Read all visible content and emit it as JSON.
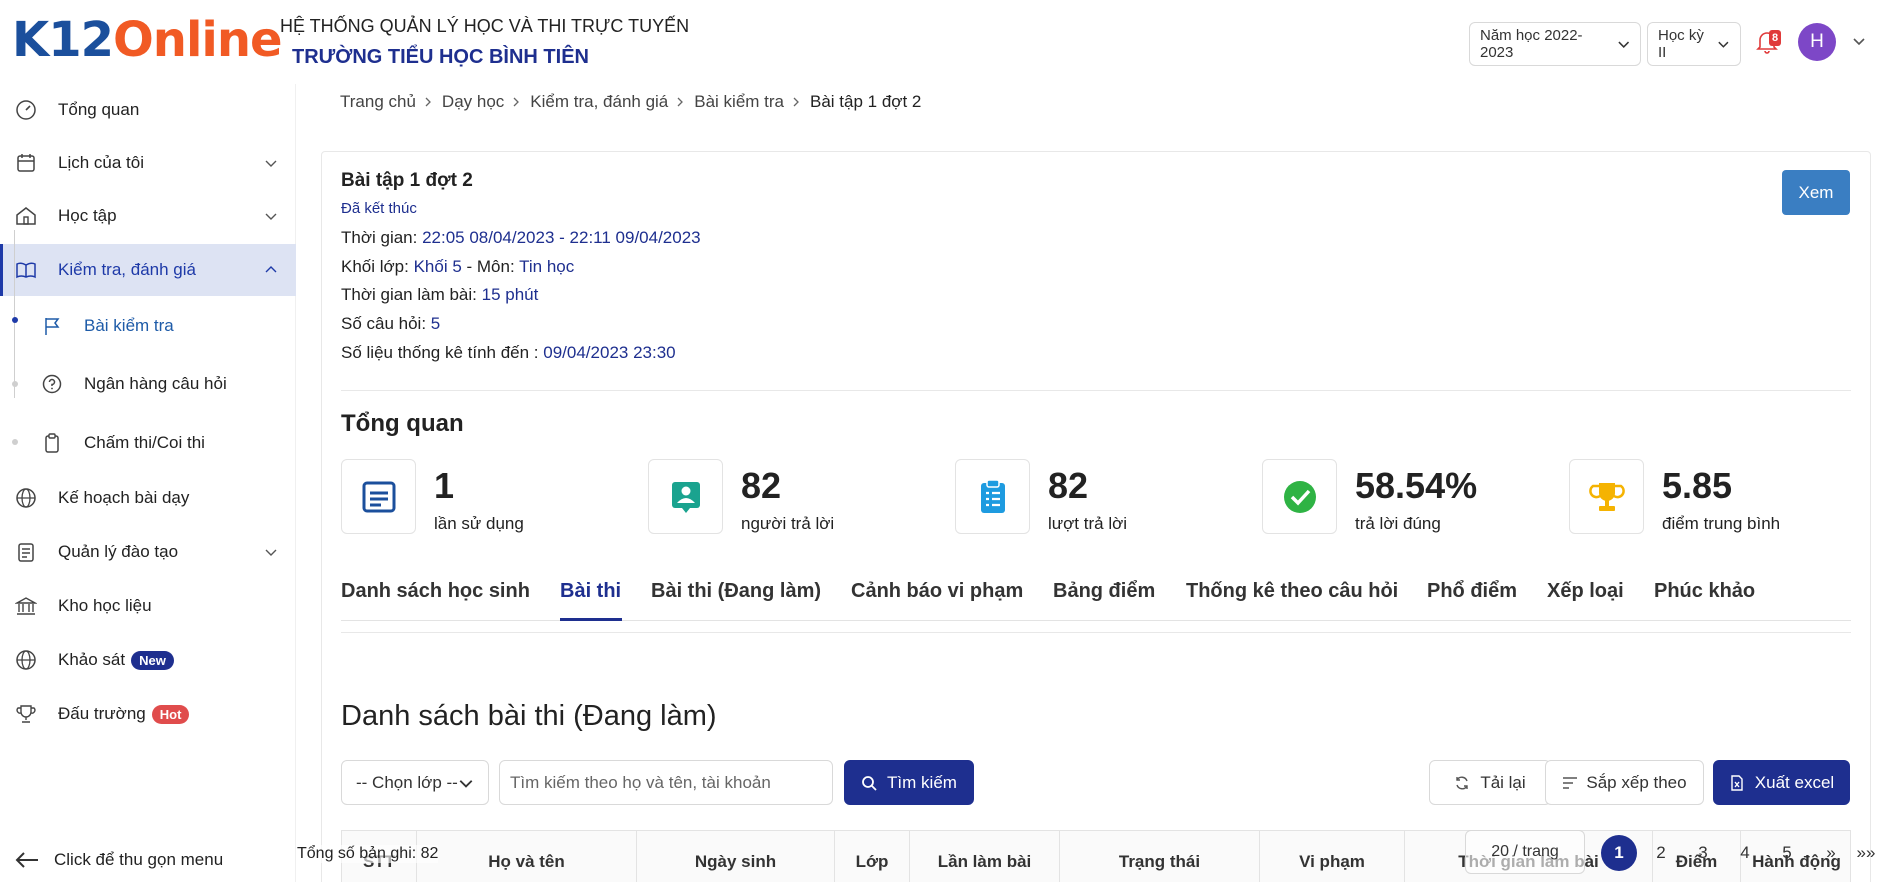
{
  "header": {
    "logo_k12": "K12",
    "logo_online": "Online",
    "system_title": "HỆ THỐNG QUẢN LÝ HỌC VÀ THI TRỰC TUYẾN",
    "school_name": "TRƯỜNG TIỂU HỌC BÌNH TIÊN",
    "school_year": "Năm học 2022-2023",
    "term": "Học kỳ II",
    "notification_count": "8",
    "avatar_letter": "H"
  },
  "sidebar": {
    "items": [
      {
        "label": "Tổng quan",
        "icon": "dashboard-icon"
      },
      {
        "label": "Lịch của tôi",
        "icon": "calendar-icon"
      },
      {
        "label": "Học tập",
        "icon": "school-icon"
      },
      {
        "label": "Kiểm tra, đánh giá",
        "icon": "book-open-icon"
      },
      {
        "label": "Kế hoạch bài dạy",
        "icon": "globe-icon"
      },
      {
        "label": "Quản lý đào tạo",
        "icon": "clipboard-list-icon"
      },
      {
        "label": "Kho học liệu",
        "icon": "library-icon"
      },
      {
        "label": "Khảo sát",
        "icon": "globe-icon"
      },
      {
        "label": "Đấu trường",
        "icon": "trophy-icon"
      }
    ],
    "sub_items": [
      {
        "label": "Bài kiểm tra",
        "icon": "flag-icon"
      },
      {
        "label": "Ngân hàng câu hỏi",
        "icon": "question-circle-icon"
      },
      {
        "label": "Chấm thi/Coi thi",
        "icon": "clipboard-icon"
      }
    ],
    "badge_new": "New",
    "badge_hot": "Hot",
    "collapse_label": "Click để thu gọn menu"
  },
  "breadcrumb": [
    "Trang chủ",
    "Dạy học",
    "Kiểm tra, đánh giá",
    "Bài kiểm tra",
    "Bài tập 1 đợt 2"
  ],
  "exam": {
    "title": "Bài tập 1 đợt 2",
    "status": "Đã kết thúc",
    "time_label": "Thời gian: ",
    "time_value": "22:05 08/04/2023 - 22:11 09/04/2023",
    "grade_label": "Khối lớp: ",
    "grade_value": "Khối 5",
    "subject_label": " - Môn: ",
    "subject_value": "Tin học",
    "duration_label": "Thời gian làm bài: ",
    "duration_value": "15 phút",
    "questions_label": "Số câu hỏi: ",
    "questions_value": "5",
    "stats_label": "Số liệu thống kê tính đến : ",
    "stats_value": "09/04/2023 23:30",
    "view_button": "Xem"
  },
  "overview": {
    "title": "Tổng quan",
    "stats": [
      {
        "value": "1",
        "label": "lần sử dụng",
        "icon": "form-icon"
      },
      {
        "value": "82",
        "label": "người trả lời",
        "icon": "person-card-icon"
      },
      {
        "value": "82",
        "label": "lượt trả lời",
        "icon": "clipboard-check-icon"
      },
      {
        "value": "58.54%",
        "label": "trả lời đúng",
        "icon": "check-circle-icon"
      },
      {
        "value": "5.85",
        "label": "điểm trung bình",
        "icon": "trophy-icon"
      }
    ]
  },
  "tabs": [
    "Danh sách học sinh",
    "Bài thi",
    "Bài thi (Đang làm)",
    "Cảnh báo vi phạm",
    "Bảng điểm",
    "Thống kê theo câu hỏi",
    "Phổ điểm",
    "Xếp loại",
    "Phúc khảo"
  ],
  "active_tab": "Bài thi",
  "list": {
    "title": "Danh sách bài thi (Đang làm)",
    "class_select": "-- Chọn lớp --",
    "search_placeholder": "Tìm kiếm theo họ và tên, tài khoản",
    "search_button": "Tìm kiếm",
    "reload_button": "Tải lại",
    "sort_button": "Sắp xếp theo",
    "export_button": "Xuất excel",
    "columns": [
      "STT",
      "Họ và tên",
      "Ngày sinh",
      "Lớp",
      "Lần làm bài",
      "Trạng thái",
      "Vi phạm",
      "Thời gian làm bài",
      "Điểm",
      "Hành động"
    ],
    "total_records": "Tổng số bản ghi: 82",
    "page_size": "20 / trang",
    "pages": [
      "1",
      "2",
      "3",
      "4",
      "5"
    ],
    "next_label": "»",
    "last_label": "»»"
  },
  "colors": {
    "primary": "#1e2f8f",
    "brand_blue": "#1b4f9c",
    "brand_orange": "#f15a24",
    "active_bg": "#dde3f3",
    "view_button": "#3a7ec2"
  }
}
